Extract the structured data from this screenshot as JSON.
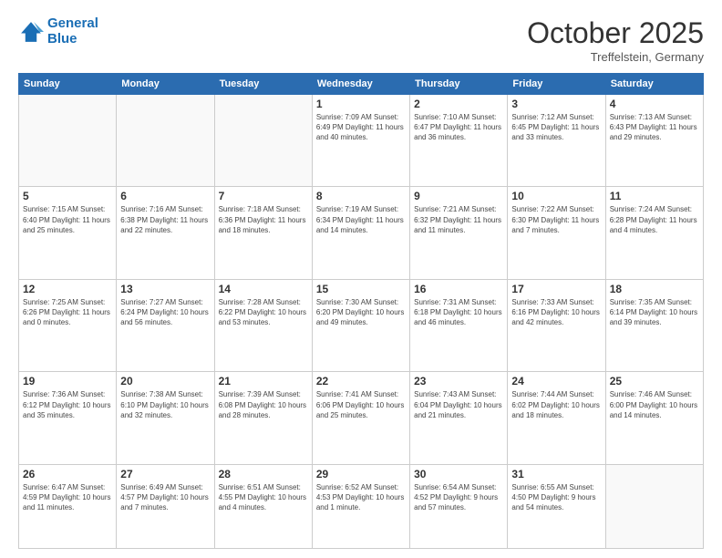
{
  "header": {
    "logo_line1": "General",
    "logo_line2": "Blue",
    "month": "October 2025",
    "location": "Treffelstein, Germany"
  },
  "weekdays": [
    "Sunday",
    "Monday",
    "Tuesday",
    "Wednesday",
    "Thursday",
    "Friday",
    "Saturday"
  ],
  "weeks": [
    [
      {
        "day": "",
        "info": ""
      },
      {
        "day": "",
        "info": ""
      },
      {
        "day": "",
        "info": ""
      },
      {
        "day": "1",
        "info": "Sunrise: 7:09 AM\nSunset: 6:49 PM\nDaylight: 11 hours\nand 40 minutes."
      },
      {
        "day": "2",
        "info": "Sunrise: 7:10 AM\nSunset: 6:47 PM\nDaylight: 11 hours\nand 36 minutes."
      },
      {
        "day": "3",
        "info": "Sunrise: 7:12 AM\nSunset: 6:45 PM\nDaylight: 11 hours\nand 33 minutes."
      },
      {
        "day": "4",
        "info": "Sunrise: 7:13 AM\nSunset: 6:43 PM\nDaylight: 11 hours\nand 29 minutes."
      }
    ],
    [
      {
        "day": "5",
        "info": "Sunrise: 7:15 AM\nSunset: 6:40 PM\nDaylight: 11 hours\nand 25 minutes."
      },
      {
        "day": "6",
        "info": "Sunrise: 7:16 AM\nSunset: 6:38 PM\nDaylight: 11 hours\nand 22 minutes."
      },
      {
        "day": "7",
        "info": "Sunrise: 7:18 AM\nSunset: 6:36 PM\nDaylight: 11 hours\nand 18 minutes."
      },
      {
        "day": "8",
        "info": "Sunrise: 7:19 AM\nSunset: 6:34 PM\nDaylight: 11 hours\nand 14 minutes."
      },
      {
        "day": "9",
        "info": "Sunrise: 7:21 AM\nSunset: 6:32 PM\nDaylight: 11 hours\nand 11 minutes."
      },
      {
        "day": "10",
        "info": "Sunrise: 7:22 AM\nSunset: 6:30 PM\nDaylight: 11 hours\nand 7 minutes."
      },
      {
        "day": "11",
        "info": "Sunrise: 7:24 AM\nSunset: 6:28 PM\nDaylight: 11 hours\nand 4 minutes."
      }
    ],
    [
      {
        "day": "12",
        "info": "Sunrise: 7:25 AM\nSunset: 6:26 PM\nDaylight: 11 hours\nand 0 minutes."
      },
      {
        "day": "13",
        "info": "Sunrise: 7:27 AM\nSunset: 6:24 PM\nDaylight: 10 hours\nand 56 minutes."
      },
      {
        "day": "14",
        "info": "Sunrise: 7:28 AM\nSunset: 6:22 PM\nDaylight: 10 hours\nand 53 minutes."
      },
      {
        "day": "15",
        "info": "Sunrise: 7:30 AM\nSunset: 6:20 PM\nDaylight: 10 hours\nand 49 minutes."
      },
      {
        "day": "16",
        "info": "Sunrise: 7:31 AM\nSunset: 6:18 PM\nDaylight: 10 hours\nand 46 minutes."
      },
      {
        "day": "17",
        "info": "Sunrise: 7:33 AM\nSunset: 6:16 PM\nDaylight: 10 hours\nand 42 minutes."
      },
      {
        "day": "18",
        "info": "Sunrise: 7:35 AM\nSunset: 6:14 PM\nDaylight: 10 hours\nand 39 minutes."
      }
    ],
    [
      {
        "day": "19",
        "info": "Sunrise: 7:36 AM\nSunset: 6:12 PM\nDaylight: 10 hours\nand 35 minutes."
      },
      {
        "day": "20",
        "info": "Sunrise: 7:38 AM\nSunset: 6:10 PM\nDaylight: 10 hours\nand 32 minutes."
      },
      {
        "day": "21",
        "info": "Sunrise: 7:39 AM\nSunset: 6:08 PM\nDaylight: 10 hours\nand 28 minutes."
      },
      {
        "day": "22",
        "info": "Sunrise: 7:41 AM\nSunset: 6:06 PM\nDaylight: 10 hours\nand 25 minutes."
      },
      {
        "day": "23",
        "info": "Sunrise: 7:43 AM\nSunset: 6:04 PM\nDaylight: 10 hours\nand 21 minutes."
      },
      {
        "day": "24",
        "info": "Sunrise: 7:44 AM\nSunset: 6:02 PM\nDaylight: 10 hours\nand 18 minutes."
      },
      {
        "day": "25",
        "info": "Sunrise: 7:46 AM\nSunset: 6:00 PM\nDaylight: 10 hours\nand 14 minutes."
      }
    ],
    [
      {
        "day": "26",
        "info": "Sunrise: 6:47 AM\nSunset: 4:59 PM\nDaylight: 10 hours\nand 11 minutes."
      },
      {
        "day": "27",
        "info": "Sunrise: 6:49 AM\nSunset: 4:57 PM\nDaylight: 10 hours\nand 7 minutes."
      },
      {
        "day": "28",
        "info": "Sunrise: 6:51 AM\nSunset: 4:55 PM\nDaylight: 10 hours\nand 4 minutes."
      },
      {
        "day": "29",
        "info": "Sunrise: 6:52 AM\nSunset: 4:53 PM\nDaylight: 10 hours\nand 1 minute."
      },
      {
        "day": "30",
        "info": "Sunrise: 6:54 AM\nSunset: 4:52 PM\nDaylight: 9 hours\nand 57 minutes."
      },
      {
        "day": "31",
        "info": "Sunrise: 6:55 AM\nSunset: 4:50 PM\nDaylight: 9 hours\nand 54 minutes."
      },
      {
        "day": "",
        "info": ""
      }
    ]
  ]
}
